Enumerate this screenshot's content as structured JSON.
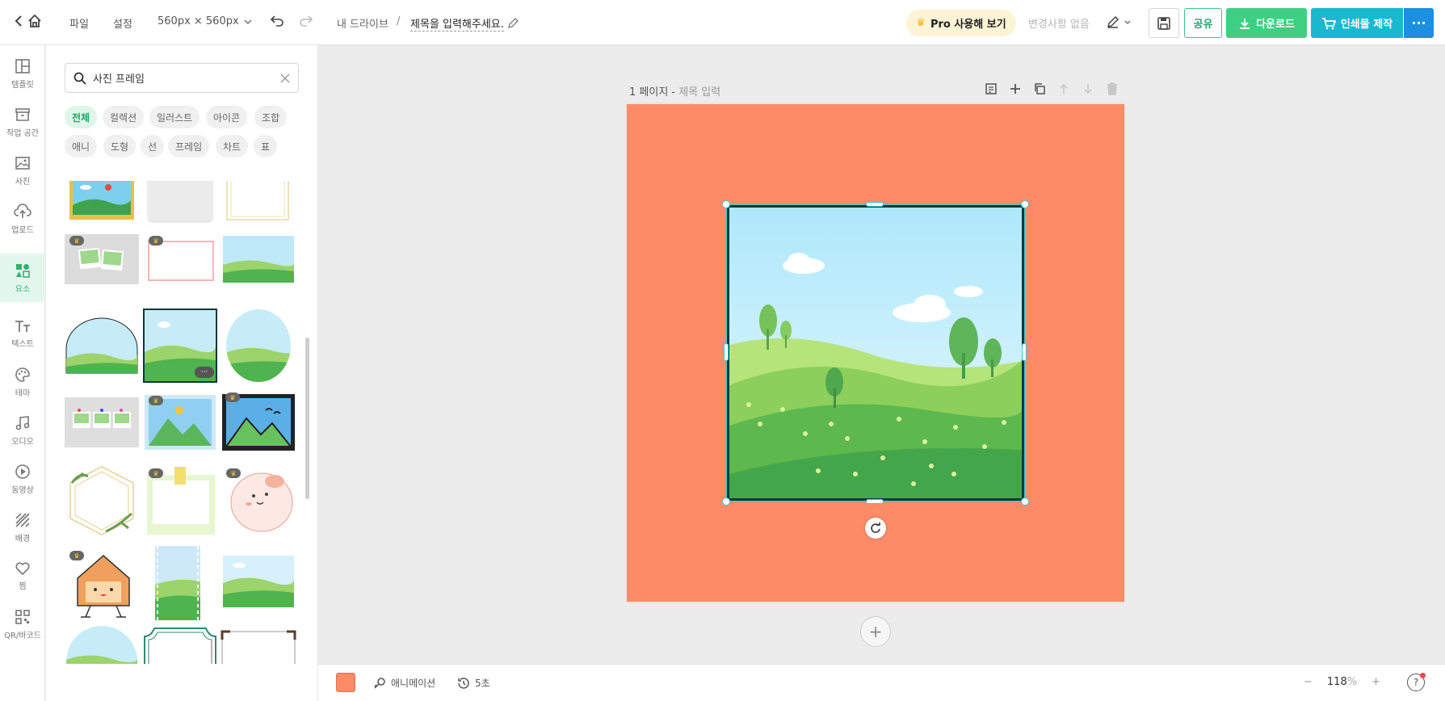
{
  "header": {
    "menu_file": "파일",
    "menu_settings": "설정",
    "canvas_size": "560px × 560px",
    "breadcrumb_drive": "내 드라이브",
    "breadcrumb_sep": "/",
    "title": "제목을 입력해주세요.",
    "pro_label": "Pro 사용해 보기",
    "save_status": "변경사항 없음",
    "share_label": "공유",
    "download_label": "다운로드",
    "print_label": "인쇄물 제작",
    "more_label": "···"
  },
  "rail": {
    "items": [
      {
        "label": "템플릿",
        "icon": "template-icon"
      },
      {
        "label": "작업 공간",
        "icon": "workspace-icon"
      },
      {
        "label": "사진",
        "icon": "photo-icon"
      },
      {
        "label": "업로드",
        "icon": "upload-icon"
      },
      {
        "label": "요소",
        "icon": "elements-icon"
      },
      {
        "label": "텍스트",
        "icon": "text-icon"
      },
      {
        "label": "테마",
        "icon": "theme-icon"
      },
      {
        "label": "오디오",
        "icon": "audio-icon"
      },
      {
        "label": "동영상",
        "icon": "video-icon"
      },
      {
        "label": "배경",
        "icon": "background-icon"
      },
      {
        "label": "찜",
        "icon": "heart-icon"
      },
      {
        "label": "QR/바코드",
        "icon": "qr-icon"
      }
    ],
    "collapse_label": "«"
  },
  "panel": {
    "search_value": "사진 프레임",
    "chips": [
      "전체",
      "컬렉션",
      "일러스트",
      "아이콘",
      "조합",
      "애니",
      "도형",
      "선",
      "프레임",
      "차트",
      "표"
    ],
    "more_badge": "···"
  },
  "canvas": {
    "page_label": "1 페이지 -",
    "page_sub": "제목 입력",
    "add_page": "+",
    "page_color": "#fe8b67"
  },
  "bottom": {
    "animation_label": "애니메이션",
    "duration_label": "5초",
    "zoom_minus": "−",
    "zoom_value": "118",
    "zoom_unit": "%",
    "zoom_plus": "+",
    "help_label": "?"
  }
}
